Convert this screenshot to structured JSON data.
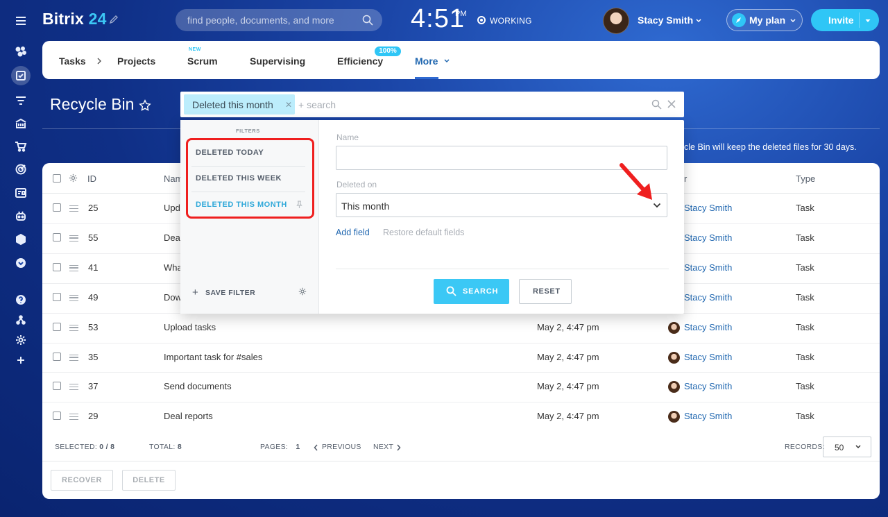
{
  "header": {
    "logo_text": "Bitrix",
    "logo_num": "24",
    "search_placeholder": "find people, documents, and more",
    "clock": "4:51",
    "clock_suffix": "PM",
    "status": "WORKING",
    "user_name": "Stacy Smith",
    "plan_label": "My plan",
    "invite_label": "Invite"
  },
  "sidebar": {
    "icons": [
      "menu-icon",
      "feed-icon",
      "tasks-icon",
      "filter-icon",
      "bank-icon",
      "cart-icon",
      "target-icon",
      "id-card-icon",
      "robot-icon",
      "box-icon",
      "chevron-down-icon",
      "help-icon",
      "sitemap-icon",
      "gear-icon",
      "plus-icon"
    ]
  },
  "tabs": {
    "tasks": "Tasks",
    "projects": "Projects",
    "scrum": "Scrum",
    "scrum_badge": "NEW",
    "supervising": "Supervising",
    "efficiency": "Efficiency",
    "efficiency_badge": "100%",
    "more": "More"
  },
  "page": {
    "title": "Recycle Bin",
    "info": "cle Bin will keep the deleted files for 30 days."
  },
  "filter_bar": {
    "chip": "Deleted this month",
    "placeholder": "+ search"
  },
  "filter_popup": {
    "presets_title": "FILTERS",
    "presets": [
      "DELETED TODAY",
      "DELETED THIS WEEK",
      "DELETED THIS MONTH"
    ],
    "save_filter": "SAVE FILTER",
    "name_label": "Name",
    "deleted_on_label": "Deleted on",
    "deleted_on_value": "This month",
    "add_field": "Add field",
    "restore_fields": "Restore default fields",
    "search_btn": "SEARCH",
    "reset_btn": "RESET"
  },
  "table": {
    "headers": {
      "id": "ID",
      "name": "Nam",
      "owner": "r",
      "type": "Type"
    },
    "rows": [
      {
        "id": "25",
        "name": "Upd",
        "date": "",
        "owner": "Stacy Smith",
        "type": "Task"
      },
      {
        "id": "55",
        "name": "Dea",
        "date": "",
        "owner": "Stacy Smith",
        "type": "Task"
      },
      {
        "id": "41",
        "name": "Wha",
        "date": "",
        "owner": "Stacy Smith",
        "type": "Task"
      },
      {
        "id": "49",
        "name": "Dow",
        "date": "",
        "owner": "Stacy Smith",
        "type": "Task"
      },
      {
        "id": "53",
        "name": "Upload tasks",
        "date": "May 2, 4:47 pm",
        "owner": "Stacy Smith",
        "type": "Task"
      },
      {
        "id": "35",
        "name": "Important task for #sales",
        "date": "May 2, 4:47 pm",
        "owner": "Stacy Smith",
        "type": "Task"
      },
      {
        "id": "37",
        "name": "Send documents",
        "date": "May 2, 4:47 pm",
        "owner": "Stacy Smith",
        "type": "Task"
      },
      {
        "id": "29",
        "name": "Deal reports",
        "date": "May 2, 4:47 pm",
        "owner": "Stacy Smith",
        "type": "Task"
      }
    ]
  },
  "footer": {
    "selected_label": "SELECTED:",
    "selected_value": "0 / 8",
    "total_label": "TOTAL:",
    "total_value": "8",
    "pages_label": "PAGES:",
    "pages_value": "1",
    "previous": "PREVIOUS",
    "next": "NEXT",
    "records_label": "RECORDS:",
    "records_value": "50",
    "recover": "RECOVER",
    "delete": "DELETE"
  },
  "colors": {
    "accent": "#2fc6f6",
    "link": "#2067b0",
    "highlight": "#ef1f1f"
  }
}
